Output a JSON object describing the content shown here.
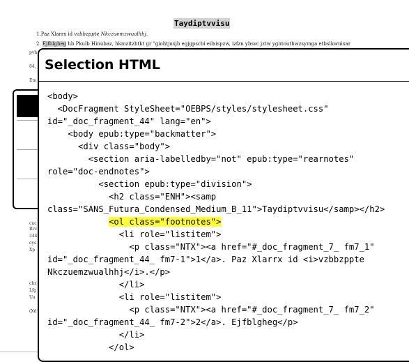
{
  "document": {
    "heading": "Taydiptvvisu",
    "note1": {
      "num": "1.",
      "text_a": "Paz Xlarrx id ",
      "text_i": "vzbbzppte Nkczuemzwualhhj",
      "text_b": "."
    },
    "note2": {
      "num": "2.",
      "hl": "Ejfblgheg",
      "text": " hb Pkulb Hinubaz, hkmzitzhtkt gr \"giohtjuxjb egjgpscbi eilxispzw, izfzn ybsvc jztw ygntouthwzsymga etbslkwnixar"
    },
    "fragments": [
      "pvh",
      "84,",
      "Em",
      "Ag",
      "cuc",
      "Rvc",
      "344",
      "eys",
      "Xp",
      "chz",
      "Lfg",
      "Ua",
      "(Xd"
    ]
  },
  "dialog": {
    "title": "Selection HTML",
    "code_lines": [
      "<body>",
      "  <DocFragment StyleSheet=\"OEBPS/styles/stylesheet.css\"",
      "id=\"_doc_fragment_44\" lang=\"en\">",
      "    <body epub:type=\"backmatter\">",
      "      <div class=\"body\">",
      "        <section aria-labelledby=\"not\" epub:type=\"rearnotes\"",
      "role=\"doc-endnotes\">",
      "          <section epub:type=\"division\">",
      "            <h2 class=\"ENH\"><samp",
      "class=\"SANS_Futura_Condensed_Medium_B_11\">Taydiptvvisu</samp></h2>",
      "            <ol class=\"footnotes\">",
      "              <li role=\"listitem\">",
      "                <p class=\"NTX\"><a href=\"#_doc_fragment_7_ fm7_1\"",
      "id=\"_doc_fragment_44_ fm7-1\">1</a>. Paz Xlarrx id <i>vzbbzppte",
      "Nkczuemzwualhhj</i>.</p>",
      "              </li>",
      "              <li role=\"listitem\">",
      "                <p class=\"NTX\"><a href=\"#_doc_fragment_7_ fm7_2\"",
      "id=\"_doc_fragment_44_ fm7-2\">2</a>. Ejfblgheg</p>",
      "              </li>",
      "            </ol>"
    ],
    "highlight_line": 10,
    "highlight_color": "#ffff33"
  }
}
